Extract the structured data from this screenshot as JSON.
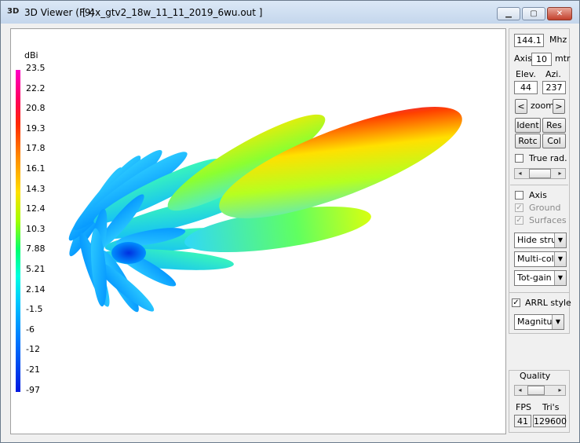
{
  "window": {
    "title": "3D Viewer (F9)",
    "icon": "3D",
    "file": "[ 4x_gtv2_18w_11_11_2019_6wu.out ]",
    "minimize_icon": "minimize-icon",
    "maximize_icon": "maximize-icon",
    "close_icon": "close-icon"
  },
  "scale": {
    "unit": "dBi",
    "ticks": [
      "23.5",
      "22.2",
      "20.8",
      "19.3",
      "17.8",
      "16.1",
      "14.3",
      "12.4",
      "10.3",
      "7.88",
      "5.21",
      "2.14",
      "-1.5",
      "-6",
      "-12",
      "-21",
      "-97"
    ]
  },
  "panel": {
    "freq_value": "144.1",
    "freq_unit": "Mhz",
    "axis_label": "Axis",
    "axis_value": "10",
    "axis_unit": "mtr",
    "elev_label": "Elev.",
    "azi_label": "Azi.",
    "elev_value": "44",
    "azi_value": "237",
    "zoom_prev": "<",
    "zoom_label": "zoom",
    "zoom_next": ">",
    "ident": "Ident",
    "res": "Res",
    "rotc": "Rotc",
    "col": "Col",
    "true_rad": "True rad.",
    "axis_check": "Axis",
    "ground_check": "Ground",
    "surfaces_check": "Surfaces",
    "select1": "Hide struc",
    "select2": "Multi-colo",
    "select3": "Tot-gain",
    "arrl_style": "ARRL style",
    "select4": "Magnitud"
  },
  "quality": {
    "label": "Quality",
    "fps_label": "FPS",
    "tris_label": "Tri's",
    "fps_value": "41",
    "tris_value": "129600"
  },
  "colors": {
    "title_gradient_top": "#dbe8f6",
    "close_red": "#c3402c",
    "lobe_max": "#c800a0",
    "lobe_min": "#0040ff"
  }
}
